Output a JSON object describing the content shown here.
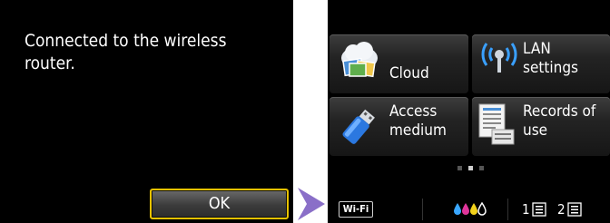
{
  "left_screen": {
    "message": "Connected to the wireless\nrouter.",
    "ok_label": "OK"
  },
  "right_screen": {
    "tiles": [
      {
        "id": "cloud",
        "label": "Cloud",
        "icon": "cloud-icon"
      },
      {
        "id": "lan",
        "label": "LAN\nsettings",
        "icon": "wireless-antenna-icon"
      },
      {
        "id": "access",
        "label": "Access\nmedium",
        "icon": "usb-drive-icon"
      },
      {
        "id": "records",
        "label": "Records of\nuse",
        "icon": "document-icon"
      }
    ],
    "status_bar": {
      "wifi_label": "Wi-Fi",
      "ink_colors": [
        "#3aa7ff",
        "#e0359a",
        "#f2d21b",
        "#ffffff"
      ],
      "tray1": "1",
      "tray2": "2"
    }
  },
  "colors": {
    "highlight_border": "#e8c200",
    "arrow": "#8a6fc8"
  }
}
